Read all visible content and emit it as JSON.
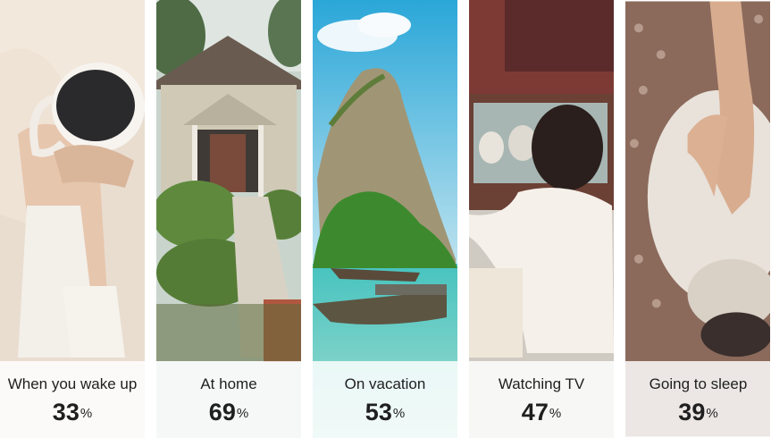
{
  "panels": [
    {
      "label": "When you wake up",
      "value": "33",
      "unit": "%",
      "image": "coffee-in-bed-photo"
    },
    {
      "label": "At home",
      "value": "69",
      "unit": "%",
      "image": "house-photo"
    },
    {
      "label": "On vacation",
      "value": "53",
      "unit": "%",
      "image": "tropical-island-photo"
    },
    {
      "label": "Watching TV",
      "value": "47",
      "unit": "%",
      "image": "baby-watching-tv-photo"
    },
    {
      "label": "Going to sleep",
      "value": "39",
      "unit": "%",
      "image": "cat-in-bed-photo"
    }
  ],
  "colors": {
    "caption_bg": "#ffffff",
    "text": "#1f1f1f"
  }
}
